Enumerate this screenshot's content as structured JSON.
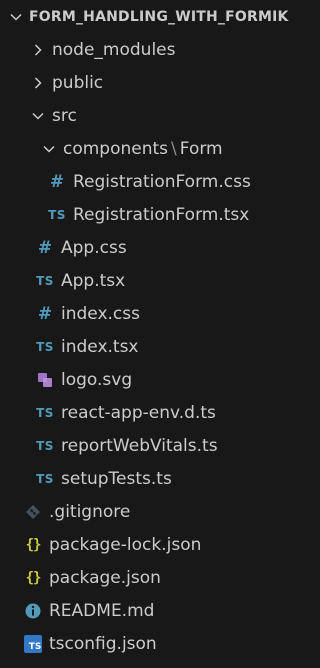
{
  "explorer": {
    "root_title": "FORM_HANDLING_WITH_FORMIK",
    "items": [
      {
        "label": "node_modules",
        "type": "folder",
        "expanded": false
      },
      {
        "label": "public",
        "type": "folder",
        "expanded": false
      },
      {
        "label": "src",
        "type": "folder",
        "expanded": true
      },
      {
        "label": "components",
        "label2": "Form",
        "separator": "\\",
        "type": "folder",
        "expanded": true
      },
      {
        "label": "RegistrationForm.css",
        "type": "file",
        "icon": "css-hash-icon"
      },
      {
        "label": "RegistrationForm.tsx",
        "type": "file",
        "icon": "typescript-icon",
        "icon_text": "TS"
      },
      {
        "label": "App.css",
        "type": "file",
        "icon": "css-hash-icon"
      },
      {
        "label": "App.tsx",
        "type": "file",
        "icon": "typescript-icon",
        "icon_text": "TS"
      },
      {
        "label": "index.css",
        "type": "file",
        "icon": "css-hash-icon"
      },
      {
        "label": "index.tsx",
        "type": "file",
        "icon": "typescript-icon",
        "icon_text": "TS"
      },
      {
        "label": "logo.svg",
        "type": "file",
        "icon": "svg-image-icon"
      },
      {
        "label": "react-app-env.d.ts",
        "type": "file",
        "icon": "typescript-icon",
        "icon_text": "TS"
      },
      {
        "label": "reportWebVitals.ts",
        "type": "file",
        "icon": "typescript-icon",
        "icon_text": "TS"
      },
      {
        "label": "setupTests.ts",
        "type": "file",
        "icon": "typescript-icon",
        "icon_text": "TS"
      },
      {
        "label": ".gitignore",
        "type": "file",
        "icon": "git-diamond-icon"
      },
      {
        "label": "package-lock.json",
        "type": "file",
        "icon": "json-braces-icon",
        "icon_text": "{}"
      },
      {
        "label": "package.json",
        "type": "file",
        "icon": "json-braces-icon",
        "icon_text": "{}"
      },
      {
        "label": "README.md",
        "type": "file",
        "icon": "info-icon"
      },
      {
        "label": "tsconfig.json",
        "type": "file",
        "icon": "tsconfig-icon",
        "icon_text": "TS"
      }
    ]
  },
  "colors": {
    "background": "#181818",
    "text": "#cccccc",
    "css_icon": "#519aba",
    "ts_icon": "#519aba",
    "json_icon": "#cbcb41",
    "svg_icon": "#a074c4",
    "git_icon": "#41535b"
  }
}
